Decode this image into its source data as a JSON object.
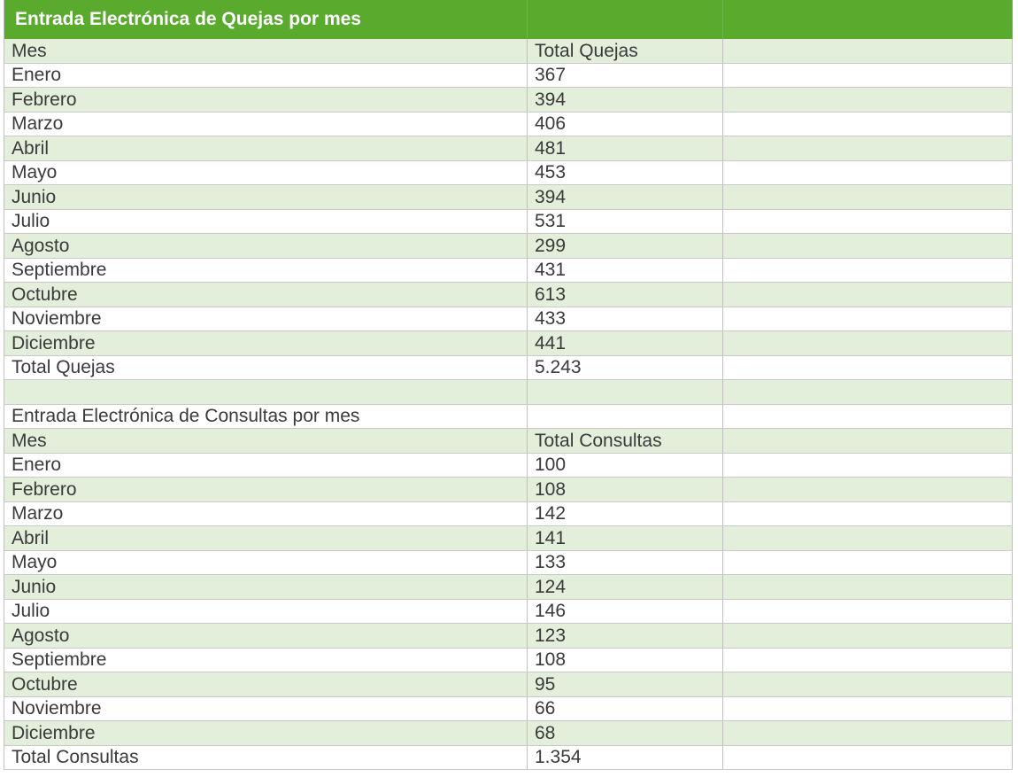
{
  "quejas": {
    "title": "Entrada Electrónica de Quejas por mes",
    "header": {
      "month": "Mes",
      "total": "Total Quejas"
    },
    "rows": [
      {
        "mes": "Enero",
        "total": "367"
      },
      {
        "mes": "Febrero",
        "total": "394"
      },
      {
        "mes": "Marzo",
        "total": "406"
      },
      {
        "mes": "Abril",
        "total": "481"
      },
      {
        "mes": "Mayo",
        "total": "453"
      },
      {
        "mes": "Junio",
        "total": "394"
      },
      {
        "mes": "Julio",
        "total": "531"
      },
      {
        "mes": "Agosto",
        "total": "299"
      },
      {
        "mes": "Septiembre",
        "total": "431"
      },
      {
        "mes": "Octubre",
        "total": "613"
      },
      {
        "mes": "Noviembre",
        "total": "433"
      },
      {
        "mes": "Diciembre",
        "total": "441"
      }
    ],
    "total_row": {
      "label": "Total Quejas",
      "value": "5.243"
    }
  },
  "consultas": {
    "title": "Entrada Electrónica de Consultas por mes",
    "header": {
      "month": "Mes",
      "total": "Total Consultas"
    },
    "rows": [
      {
        "mes": "Enero",
        "total": "100"
      },
      {
        "mes": "Febrero",
        "total": "108"
      },
      {
        "mes": "Marzo",
        "total": "142"
      },
      {
        "mes": "Abril",
        "total": "141"
      },
      {
        "mes": "Mayo",
        "total": "133"
      },
      {
        "mes": "Junio",
        "total": "124"
      },
      {
        "mes": "Julio",
        "total": "146"
      },
      {
        "mes": "Agosto",
        "total": "123"
      },
      {
        "mes": "Septiembre",
        "total": "108"
      },
      {
        "mes": "Octubre",
        "total": "95"
      },
      {
        "mes": "Noviembre",
        "total": "66"
      },
      {
        "mes": "Diciembre",
        "total": "68"
      }
    ],
    "total_row": {
      "label": "Total Consultas",
      "value": "1.354"
    }
  },
  "colors": {
    "header_green": "#5aaa2e",
    "band_green": "#e3efdb",
    "text": "#3a3a3a"
  }
}
